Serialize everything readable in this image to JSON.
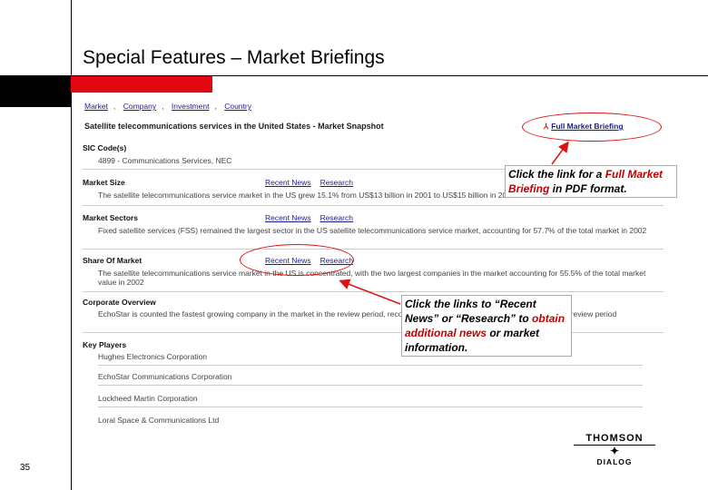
{
  "slide": {
    "title": "Special Features – Market Briefings",
    "page_number": "35"
  },
  "screenshot": {
    "nav": [
      "Market",
      "Company",
      "Investment",
      "Country"
    ],
    "nav_separator": ",",
    "heading": "Satellite telecommunications services in the United States - Market Snapshot",
    "pdf_link": "Full Market Briefing",
    "recent_news": "Recent News",
    "research": "Research",
    "sections": [
      {
        "label": "SIC Code(s)",
        "body": "4899 - Communications Services, NEC",
        "links": false
      },
      {
        "label": "Market Size",
        "body": "The satellite telecommunications service market in the US grew 15.1% from US$13 billion in 2001 to US$15 billion in 2002",
        "links": true
      },
      {
        "label": "Market Sectors",
        "body": "Fixed satellite services (FSS) remained the largest sector in the US satellite telecommunications service market, accounting for 57.7% of the total market in 2002",
        "links": true
      },
      {
        "label": "Share Of Market",
        "body": "The satellite telecommunications service market in the US is concentrated, with the two largest companies in the market accounting for 55.5% of the total market value in 2002",
        "links": true
      },
      {
        "label": "Corporate Overview",
        "body": "EchoStar is counted the fastest growing company in the market in the review period, recording an average sales growth of 70.2% over the review period",
        "links": false
      },
      {
        "label": "Key Players",
        "body": "",
        "links": false
      }
    ],
    "key_players": [
      "Hughes Electronics Corporation",
      "EchoStar Communications Corporation",
      "Lockheed Martin Corporation",
      "Loral Space & Communications Ltd"
    ]
  },
  "callouts": {
    "pdf": {
      "prefix": "Click the link for a ",
      "highlight": "Full Market Briefing",
      "suffix": " in PDF format."
    },
    "news": {
      "prefix": "Click the links to “Recent News” or “Research” to ",
      "highlight": "obtain additional news",
      "suffix": " or market information."
    }
  },
  "logo": {
    "word1": "THOMSON",
    "word2": "DIALOG"
  },
  "colors": {
    "accent_red": "#e30613",
    "link_blue": "#1d1d8c",
    "highlight_red": "#c40000"
  },
  "icons": [
    "pdf-icon",
    "star-icon"
  ]
}
